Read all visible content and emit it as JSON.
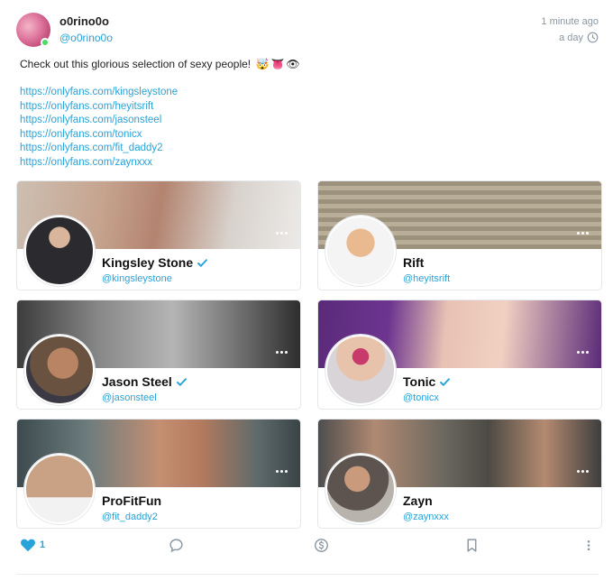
{
  "author": {
    "name": "o0rino0o",
    "handle": "@o0rino0o",
    "posted": "1 minute ago",
    "expires": "a day"
  },
  "post": {
    "text": "Check out this glorious selection of sexy people!",
    "emojis": [
      "🤯",
      "👅",
      "👁"
    ],
    "links": [
      "https://onlyfans.com/kingsleystone",
      "https://onlyfans.com/heyitsrift",
      "https://onlyfans.com/jasonsteel",
      "https://onlyfans.com/tonicx",
      "https://onlyfans.com/fit_daddy2",
      "https://onlyfans.com/zaynxxx"
    ]
  },
  "cards": [
    {
      "name": "Kingsley Stone",
      "handle": "@kingsleystone",
      "verified": true
    },
    {
      "name": "Rift",
      "handle": "@heyitsrift",
      "verified": false
    },
    {
      "name": "Jason Steel",
      "handle": "@jasonsteel",
      "verified": true
    },
    {
      "name": "Tonic",
      "handle": "@tonicx",
      "verified": true
    },
    {
      "name": "ProFitFun",
      "handle": "@fit_daddy2",
      "verified": false
    },
    {
      "name": "Zayn",
      "handle": "@zaynxxx",
      "verified": false
    }
  ],
  "footer": {
    "like_count": "1",
    "icons": [
      "heart-icon",
      "comment-icon",
      "tip-icon",
      "bookmark-icon",
      "more-vertical-icon"
    ]
  },
  "colors": {
    "accent": "#27a3d9",
    "like": "#27a3d9",
    "muted": "#8a96a3"
  }
}
